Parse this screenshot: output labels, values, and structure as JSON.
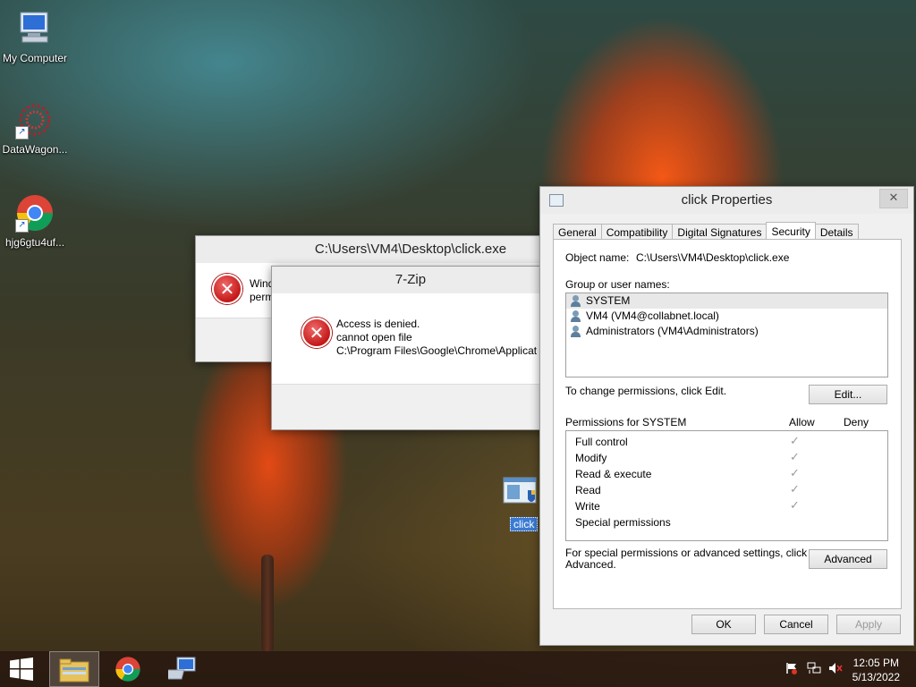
{
  "desktop": {
    "icons": [
      {
        "label": "My Computer"
      },
      {
        "label": "DataWagon..."
      },
      {
        "label": "hjg6gtu4uf..."
      }
    ],
    "file_icon_label": "click"
  },
  "error_window": {
    "title": "C:\\Users\\VM4\\Desktop\\click.exe",
    "message_line1": "Wind",
    "message_line2": "perm"
  },
  "zip_dialog": {
    "title": "7-Zip",
    "line1": "Access is denied.",
    "line2": "cannot open file",
    "line3": "C:\\Program Files\\Google\\Chrome\\Applicat"
  },
  "properties": {
    "title": "click Properties",
    "close": "✕",
    "tabs": [
      "General",
      "Compatibility",
      "Digital Signatures",
      "Security",
      "Details"
    ],
    "active_tab": "Security",
    "object_name_label": "Object name:",
    "object_name_value": "C:\\Users\\VM4\\Desktop\\click.exe",
    "group_label": "Group or user names:",
    "users": [
      "SYSTEM",
      "VM4 (VM4@collabnet.local)",
      "Administrators (VM4\\Administrators)"
    ],
    "change_perm_text": "To change permissions, click Edit.",
    "edit_button": "Edit...",
    "permissions_for": "Permissions for SYSTEM",
    "allow_header": "Allow",
    "deny_header": "Deny",
    "permissions": [
      {
        "name": "Full control",
        "allow": true
      },
      {
        "name": "Modify",
        "allow": true
      },
      {
        "name": "Read & execute",
        "allow": true
      },
      {
        "name": "Read",
        "allow": true
      },
      {
        "name": "Write",
        "allow": true
      },
      {
        "name": "Special permissions",
        "allow": false
      }
    ],
    "special_text_line1": "For special permissions or advanced settings, click",
    "special_text_line2": "Advanced.",
    "advanced_button": "Advanced",
    "ok_button": "OK",
    "cancel_button": "Cancel",
    "apply_button": "Apply"
  },
  "taskbar": {
    "time": "12:05 PM",
    "date": "5/13/2022"
  },
  "check_glyph": "✓"
}
